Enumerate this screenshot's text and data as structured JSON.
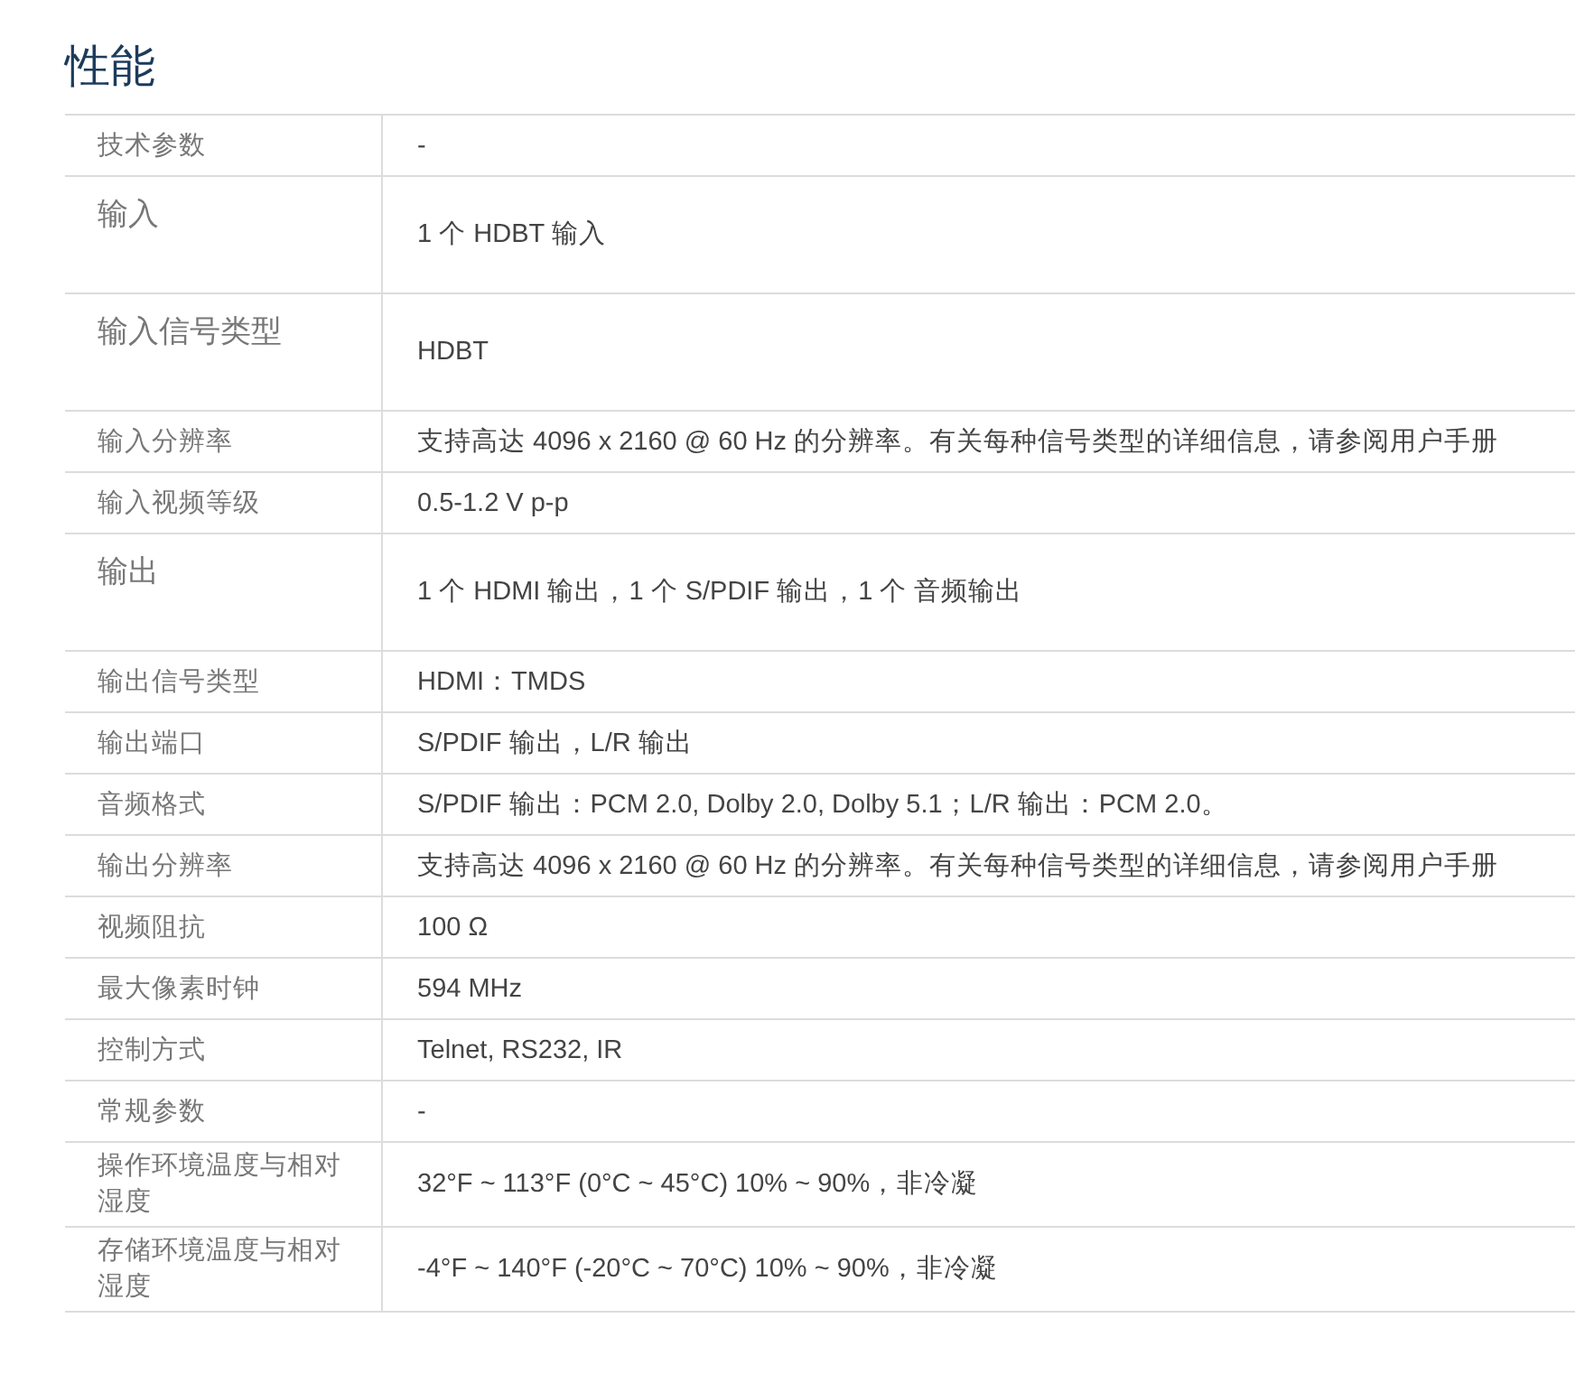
{
  "title": "性能",
  "rows": [
    {
      "kind": "normal",
      "label": "技术参数",
      "value": "-"
    },
    {
      "kind": "tall",
      "label": "输入",
      "value": "1 个 HDBT 输入"
    },
    {
      "kind": "tall",
      "label": "输入信号类型",
      "value": "HDBT"
    },
    {
      "kind": "normal",
      "label": "输入分辨率",
      "value": "支持高达 4096 x 2160 @ 60 Hz 的分辨率。有关每种信号类型的详细信息，请参阅用户手册"
    },
    {
      "kind": "normal",
      "label": "输入视频等级",
      "value": "0.5-1.2 V p-p"
    },
    {
      "kind": "tall",
      "label": "输出",
      "value": "1 个 HDMI 输出，1 个 S/PDIF 输出，1 个 音频输出"
    },
    {
      "kind": "normal",
      "label": "输出信号类型",
      "value": "HDMI：TMDS"
    },
    {
      "kind": "normal",
      "label": "输出端口",
      "value": "S/PDIF 输出，L/R 输出"
    },
    {
      "kind": "normal",
      "label": "音频格式",
      "value": "S/PDIF 输出：PCM 2.0, Dolby 2.0, Dolby 5.1；L/R 输出：PCM 2.0。"
    },
    {
      "kind": "normal",
      "label": "输出分辨率",
      "value": "支持高达 4096 x 2160 @ 60 Hz 的分辨率。有关每种信号类型的详细信息，请参阅用户手册"
    },
    {
      "kind": "normal",
      "label": "视频阻抗",
      "value": "100 Ω"
    },
    {
      "kind": "normal",
      "label": "最大像素时钟",
      "value": "594 MHz"
    },
    {
      "kind": "normal",
      "label": "控制方式",
      "value": "Telnet, RS232, IR"
    },
    {
      "kind": "normal",
      "label": "常规参数",
      "value": "-"
    },
    {
      "kind": "normal",
      "label": "操作环境温度与相对湿度",
      "value": "32°F ~ 113°F (0°C ~ 45°C) 10% ~ 90%，非冷凝"
    },
    {
      "kind": "normal",
      "label": "存储环境温度与相对湿度",
      "value": "-4°F ~ 140°F (-20°C ~ 70°C) 10% ~ 90%，非冷凝"
    }
  ]
}
